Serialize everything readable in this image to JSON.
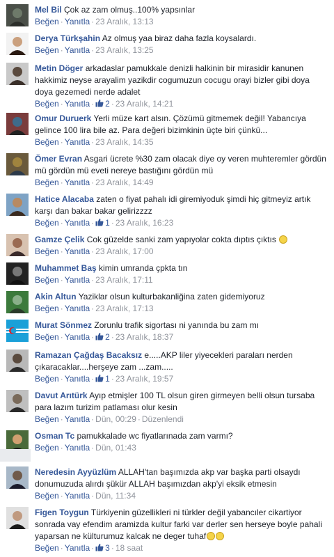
{
  "ui": {
    "like_label": "Beğen",
    "reply_label": "Yanıtla",
    "separator": "·"
  },
  "comments": [
    {
      "author": "Mel Bil",
      "text": "Çok az zam olmuş..100% yapsınlar",
      "likes": "",
      "time": "23 Aralık, 13:13",
      "edited": ""
    },
    {
      "author": "Derya Türkşahin",
      "text": "Az olmuş yaa biraz daha fazla koysalardı.",
      "likes": "",
      "time": "23 Aralık, 13:25",
      "edited": ""
    },
    {
      "author": "Metin Döger",
      "text": "arkadaslar pamukkale denizli halkinin bir mirasidir kanunen hakkimiz neyse arayalim yazikdir cogumuzun cocugu orayi bizler gibi doya doya gezemedi nerde adalet",
      "likes": "2",
      "time": "23 Aralık, 14:21",
      "edited": ""
    },
    {
      "author": "Omur Duruerk",
      "text": "Yerli müze kart alsın. Çözümü gitmemek değil! Yabancıya gelince 100 lira bile az. Para değeri bizimkinin üçte biri çünkü...",
      "likes": "",
      "time": "23 Aralık, 14:35",
      "edited": ""
    },
    {
      "author": "Ömer Evran",
      "text": "Asgari ücrete %30 zam olacak diye oy veren muhteremler gördün mü gördün mü eveti nereye bastığını gördün mü",
      "likes": "",
      "time": "23 Aralık, 14:49",
      "edited": ""
    },
    {
      "author": "Hatice Alacaba",
      "text": "zaten o fiyat pahalı idi giremiyoduk şimdi hiç gitmeyiz artık karşı dan bakar bakar gelirizzzz",
      "likes": "1",
      "time": "23 Aralık, 16:23",
      "edited": ""
    },
    {
      "author": "Gamze Çelik",
      "text": "Cok güzelde sanki zam yapıyolar cokta dıptıs çıktıs",
      "likes": "",
      "time": "23 Aralık, 17:00",
      "edited": "",
      "emoji": true
    },
    {
      "author": "Muhammet Baş",
      "text": "kimin umranda çpkta tın",
      "likes": "",
      "time": "23 Aralık, 17:11",
      "edited": ""
    },
    {
      "author": "Akin Altun",
      "text": "Yaziklar olsun kulturbakanliğina zaten gidemiyoruz",
      "likes": "",
      "time": "23 Aralık, 17:13",
      "edited": ""
    },
    {
      "author": "Murat Sönmez",
      "text": "Zorunlu trafik sigortası ni yanında bu zam mı",
      "likes": "2",
      "time": "23 Aralık, 18:37",
      "edited": ""
    },
    {
      "author": "Ramazan Çağdaş Bacaksız",
      "text": "e.....AKP liler yiyecekleri paraları nerden çıkaracaklar....herşeye zam ...zam.....",
      "likes": "1",
      "time": "23 Aralık, 19:57",
      "edited": ""
    },
    {
      "author": "Davut Arıtürk",
      "text": "Ayıp etmişler 100 TL olsun giren girmeyen belli olsun tursaba para lazım turizim patlaması olur kesin",
      "likes": "",
      "time": "Dün, 00:29",
      "edited": "Düzenlendi"
    },
    {
      "author": "Osman Tc",
      "text": "pamukkalade wc fiyatlarınada zam varmı?",
      "likes": "",
      "time": "Dün, 01:43",
      "edited": ""
    },
    {
      "author": "Neredesin Ayyüzlüm",
      "text": "ALLAH'tan başımızda akp var başka parti olsaydı donumuzuda alırdı şükür ALLAH başımızdan akp'yi eksik etmesin",
      "likes": "",
      "time": "Dün, 11:34",
      "edited": ""
    },
    {
      "author": "Figen Toygun",
      "text": "Türkiyenin güzellikleri ni türkler değil yabancıler cikartiyor sonrada vay efendim aramizda kultur farki var derler sen herseye boyle pahali yaparsan ne külturumuz kalcak ne deger tuhaf",
      "likes": "3",
      "time": "18 saat",
      "edited": "",
      "emoji2": true
    }
  ],
  "colors": {
    "link": "#365899",
    "meta": "#90949c",
    "text": "#1d2129"
  }
}
